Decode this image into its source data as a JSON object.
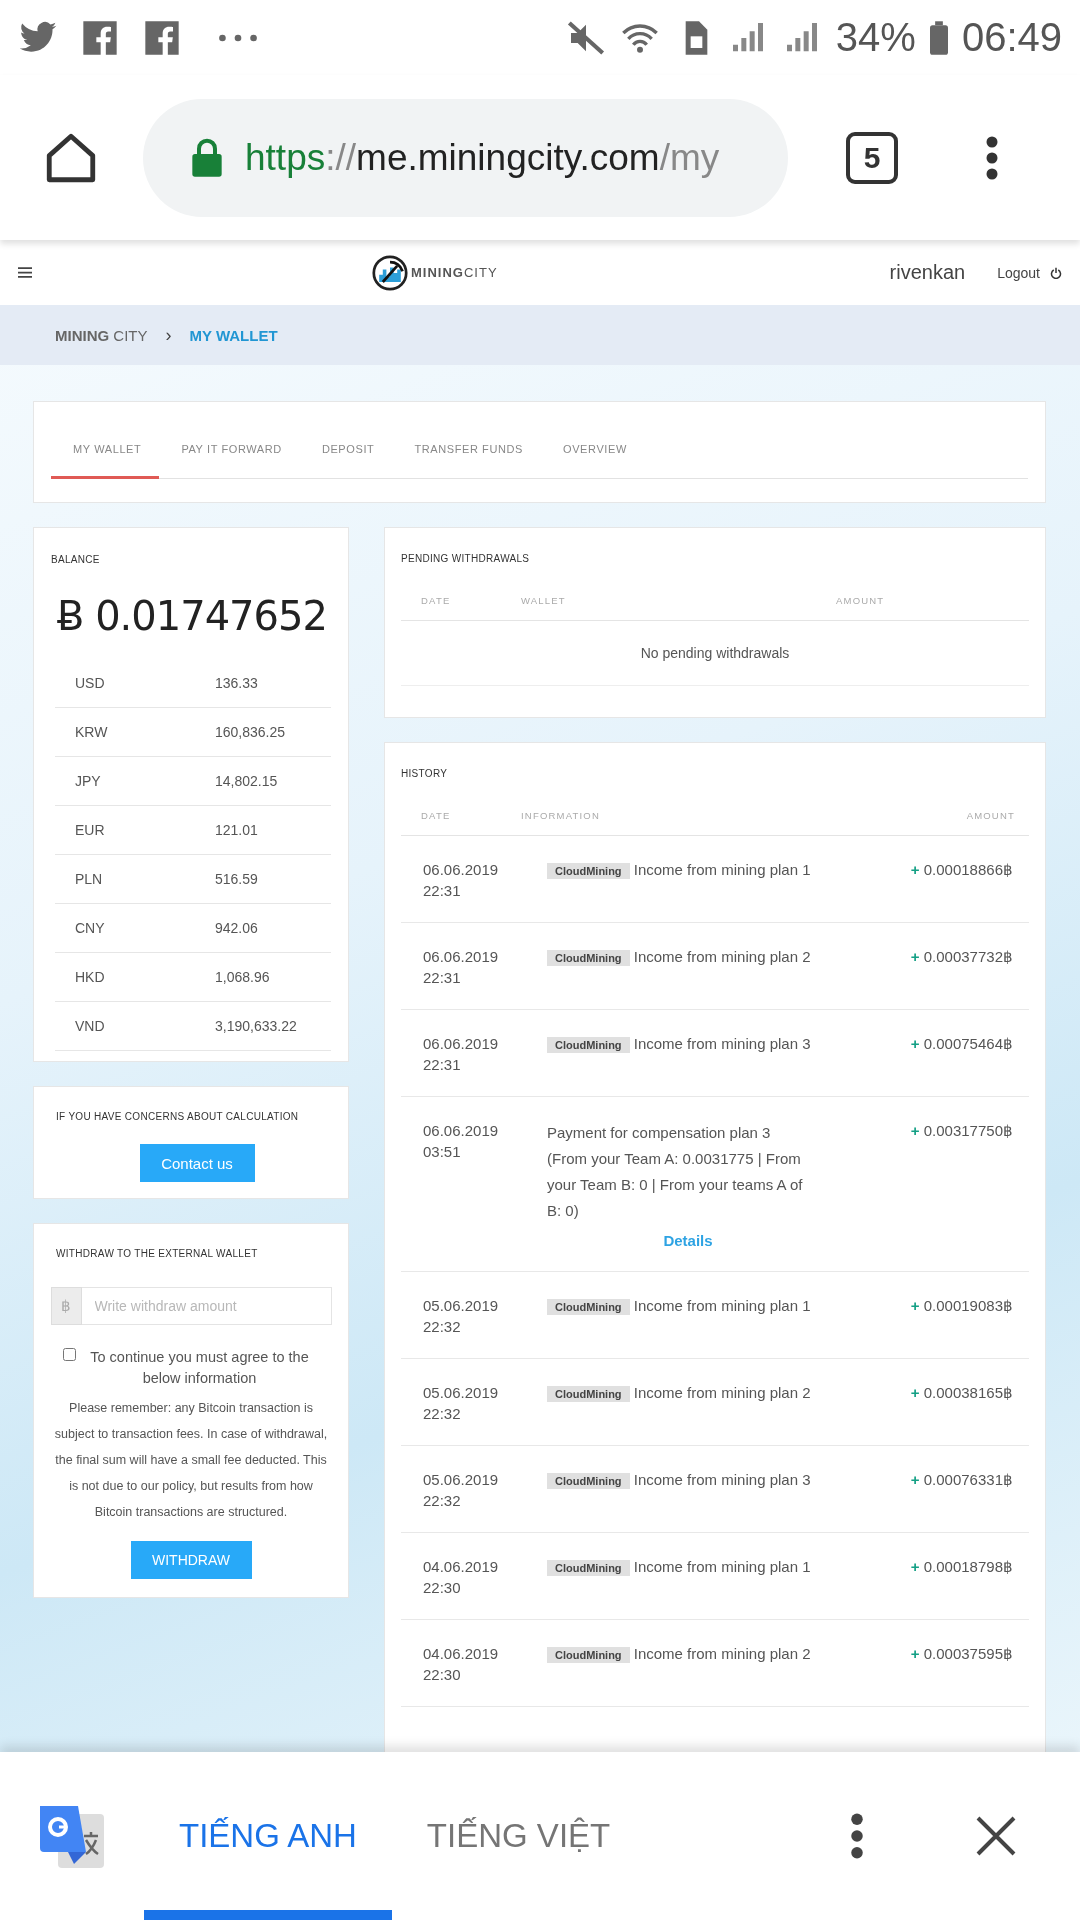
{
  "status_bar": {
    "battery": "34%",
    "time": "06:49"
  },
  "browser": {
    "url": {
      "scheme": "https",
      "separator": "://",
      "host": "me.miningcity.com",
      "path": "/my"
    },
    "tab_count": "5"
  },
  "header": {
    "brand": "**MINING**CITY",
    "username": "rivenkan",
    "logout": "Logout"
  },
  "breadcrumb": {
    "items": [
      {
        "label": "**MINING** CITY",
        "current": false
      },
      {
        "label": "MY WALLET",
        "current": true
      }
    ],
    "separator": "›"
  },
  "tabs": [
    {
      "label": "MY WALLET",
      "selected": true
    },
    {
      "label": "PAY IT FORWARD",
      "selected": false
    },
    {
      "label": "DEPOSIT",
      "selected": false
    },
    {
      "label": "TRANSFER FUNDS",
      "selected": false
    },
    {
      "label": "OVERVIEW",
      "selected": false
    }
  ],
  "balance": {
    "title": "BALANCE",
    "amount": "Ƀ 0.01747652",
    "currencies": [
      {
        "code": "USD",
        "value": "136.33"
      },
      {
        "code": "KRW",
        "value": "160,836.25"
      },
      {
        "code": "JPY",
        "value": "14,802.15"
      },
      {
        "code": "EUR",
        "value": "121.01"
      },
      {
        "code": "PLN",
        "value": "516.59"
      },
      {
        "code": "CNY",
        "value": "942.06"
      },
      {
        "code": "HKD",
        "value": "1,068.96"
      },
      {
        "code": "VND",
        "value": "3,190,633.22"
      }
    ]
  },
  "concerns": {
    "title": "IF YOU HAVE CONCERNS ABOUT CALCULATION",
    "button": "Contact us"
  },
  "withdraw": {
    "title": "WITHDRAW TO THE EXTERNAL WALLET",
    "currency_symbol": "฿",
    "placeholder": "Write withdraw amount",
    "agree": {
      "checked": false,
      "label": "To continue you must agree to the below information"
    },
    "notice": "Please remember: any Bitcoin transaction is subject to transaction fees. In case of withdrawal, the final sum will have a small fee deducted. This is not due to our policy, but results from how Bitcoin transactions are structured.",
    "button": "WITHDRAW"
  },
  "pending": {
    "title": "PENDING WITHDRAWALS",
    "columns": [
      "DATE",
      "WALLET",
      "AMOUNT"
    ],
    "empty": "No pending withdrawals"
  },
  "history": {
    "title": "HISTORY",
    "columns": [
      "DATE",
      "INFORMATION",
      "AMOUNT"
    ],
    "rows": [
      {
        "kind": "mining",
        "date": "06.06.2019",
        "time": "22:31",
        "tag": "CloudMining",
        "info": "Income from mining plan 1",
        "sign": "+",
        "amount": "0.00018866฿"
      },
      {
        "kind": "mining",
        "date": "06.06.2019",
        "time": "22:31",
        "tag": "CloudMining",
        "info": "Income from mining plan 2",
        "sign": "+",
        "amount": "0.00037732฿"
      },
      {
        "kind": "mining",
        "date": "06.06.2019",
        "time": "22:31",
        "tag": "CloudMining",
        "info": "Income from mining plan 3",
        "sign": "+",
        "amount": "0.00075464฿"
      },
      {
        "kind": "compensation",
        "date": "06.06.2019",
        "time": "03:51",
        "info": "Payment for compensation plan 3 (From your Team A: 0.0031775 | From your Team B: 0 | From your teams A of B: 0)",
        "link": "Details",
        "sign": "+",
        "amount": "0.00317750฿"
      },
      {
        "kind": "mining",
        "date": "05.06.2019",
        "time": "22:32",
        "tag": "CloudMining",
        "info": "Income from mining plan 1",
        "sign": "+",
        "amount": "0.00019083฿"
      },
      {
        "kind": "mining",
        "date": "05.06.2019",
        "time": "22:32",
        "tag": "CloudMining",
        "info": "Income from mining plan 2",
        "sign": "+",
        "amount": "0.00038165฿"
      },
      {
        "kind": "mining",
        "date": "05.06.2019",
        "time": "22:32",
        "tag": "CloudMining",
        "info": "Income from mining plan 3",
        "sign": "+",
        "amount": "0.00076331฿"
      },
      {
        "kind": "mining",
        "date": "04.06.2019",
        "time": "22:30",
        "tag": "CloudMining",
        "info": "Income from mining plan 1",
        "sign": "+",
        "amount": "0.00018798฿"
      },
      {
        "kind": "mining",
        "date": "04.06.2019",
        "time": "22:30",
        "tag": "CloudMining",
        "info": "Income from mining plan 2",
        "sign": "+",
        "amount": "0.00037595฿"
      }
    ]
  },
  "translate_bar": {
    "languages": [
      {
        "label": "TIẾNG ANH",
        "selected": true
      },
      {
        "label": "TIẾNG VIỆT",
        "selected": false
      }
    ]
  }
}
